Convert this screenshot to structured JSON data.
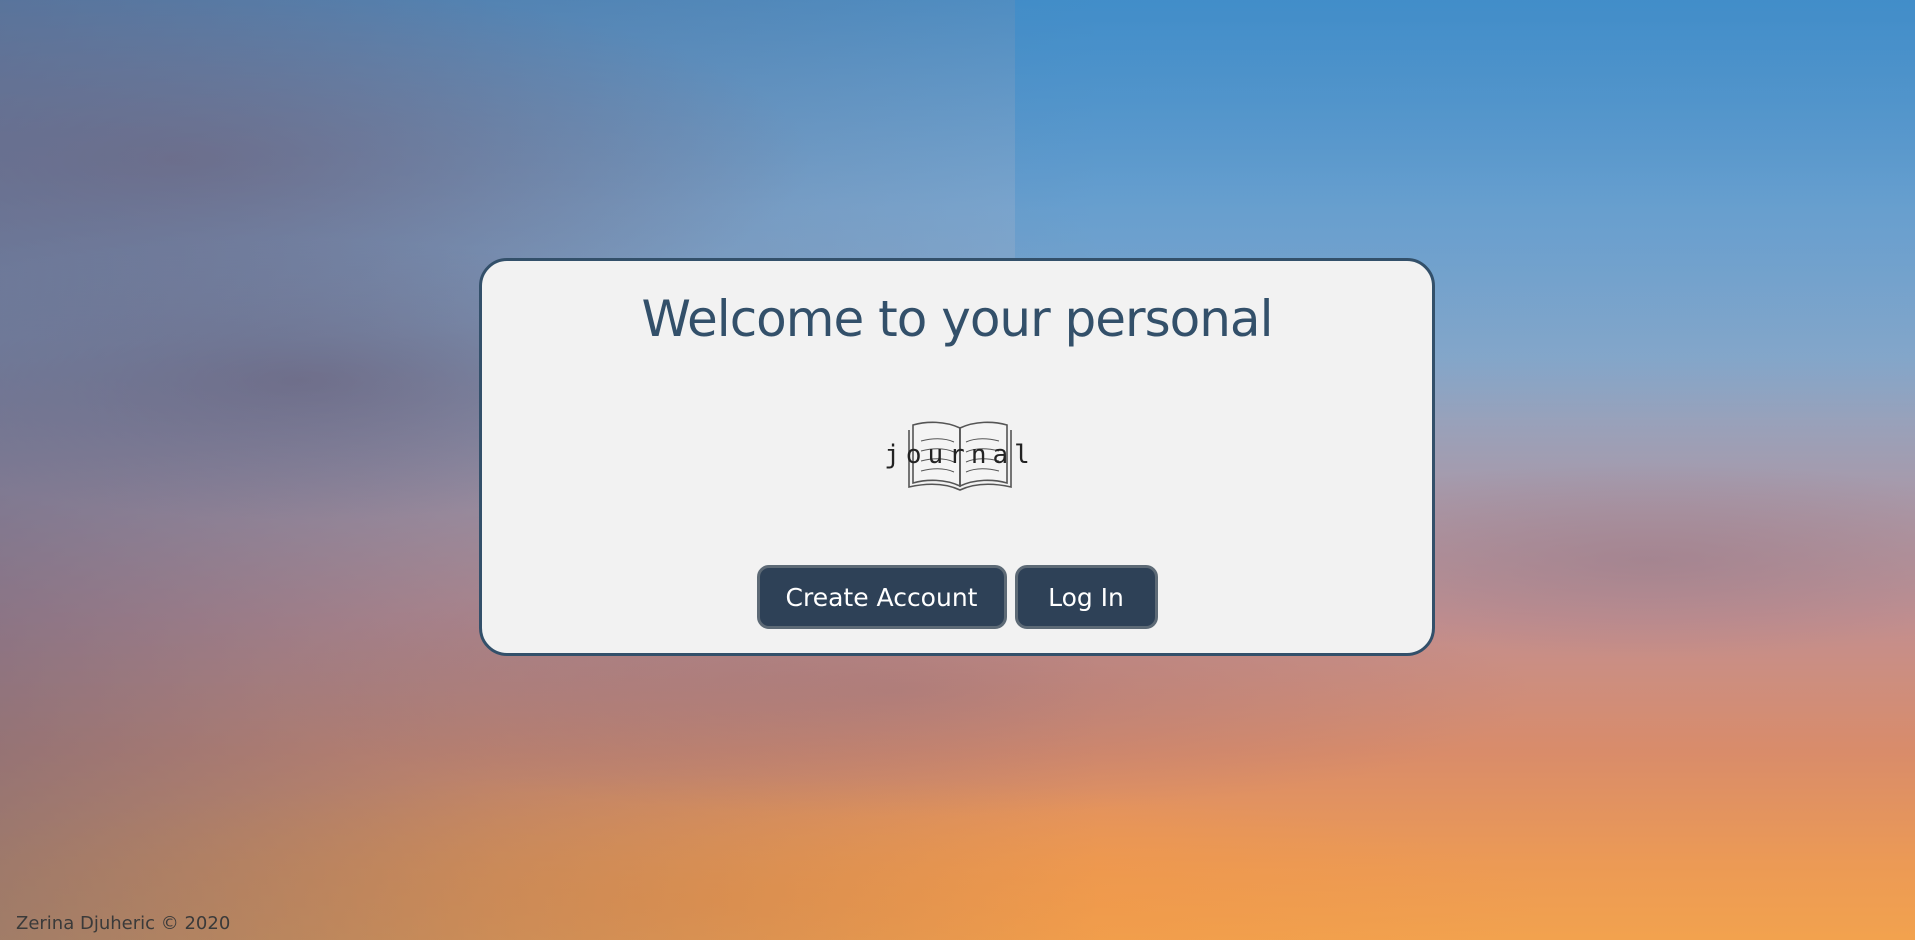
{
  "welcome": {
    "heading": "Welcome to your personal",
    "logo_word": "journal",
    "logo_icon": "open-book-icon"
  },
  "actions": {
    "create_account_label": "Create Account",
    "login_label": "Log In"
  },
  "footer": {
    "copyright": "Zerina Djuheric © 2020"
  },
  "colors": {
    "accent": "#33506a",
    "button_bg": "#2e4157",
    "card_bg": "#f2f2f2"
  }
}
